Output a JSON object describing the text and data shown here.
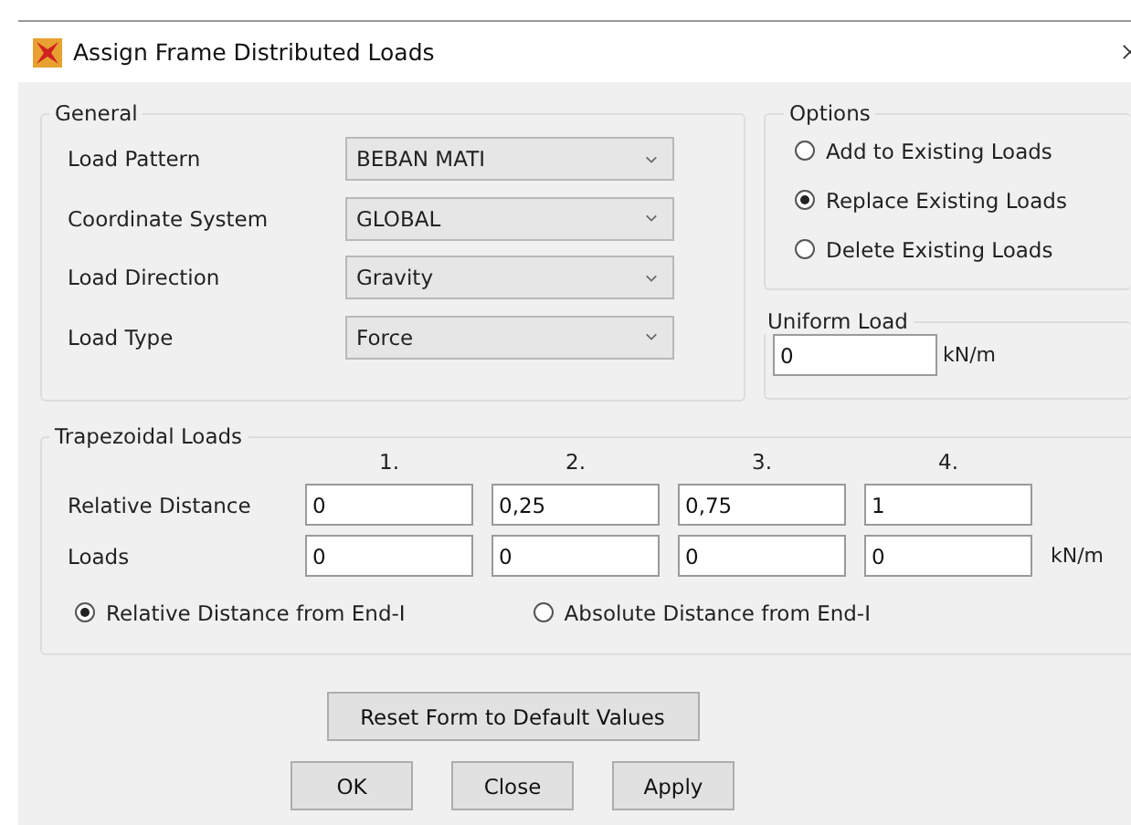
{
  "window": {
    "title": "Assign Frame Distributed Loads"
  },
  "general": {
    "title": "General",
    "fields": [
      {
        "label": "Load Pattern",
        "value": "BEBAN MATI"
      },
      {
        "label": "Coordinate System",
        "value": "GLOBAL"
      },
      {
        "label": "Load Direction",
        "value": "Gravity"
      },
      {
        "label": "Load Type",
        "value": "Force"
      }
    ]
  },
  "options": {
    "title": "Options",
    "items": [
      {
        "label": "Add to Existing Loads",
        "selected": false
      },
      {
        "label": "Replace Existing Loads",
        "selected": true
      },
      {
        "label": "Delete Existing Loads",
        "selected": false
      }
    ]
  },
  "uniform_load": {
    "title": "Uniform Load",
    "value": "0",
    "unit": "kN/m"
  },
  "trapezoidal": {
    "title": "Trapezoidal Loads",
    "columns": [
      "1.",
      "2.",
      "3.",
      "4."
    ],
    "rows": [
      {
        "label": "Relative Distance",
        "values": [
          "0",
          "0,25",
          "0,75",
          "1"
        ]
      },
      {
        "label": "Loads",
        "values": [
          "0",
          "0",
          "0",
          "0"
        ],
        "unit": "kN/m"
      }
    ],
    "distance_modes": [
      {
        "label": "Relative Distance from End-I",
        "selected": true
      },
      {
        "label": "Absolute Distance from End-I",
        "selected": false
      }
    ]
  },
  "reset_button": "Reset Form to Default Values",
  "buttons": [
    "OK",
    "Close",
    "Apply"
  ]
}
